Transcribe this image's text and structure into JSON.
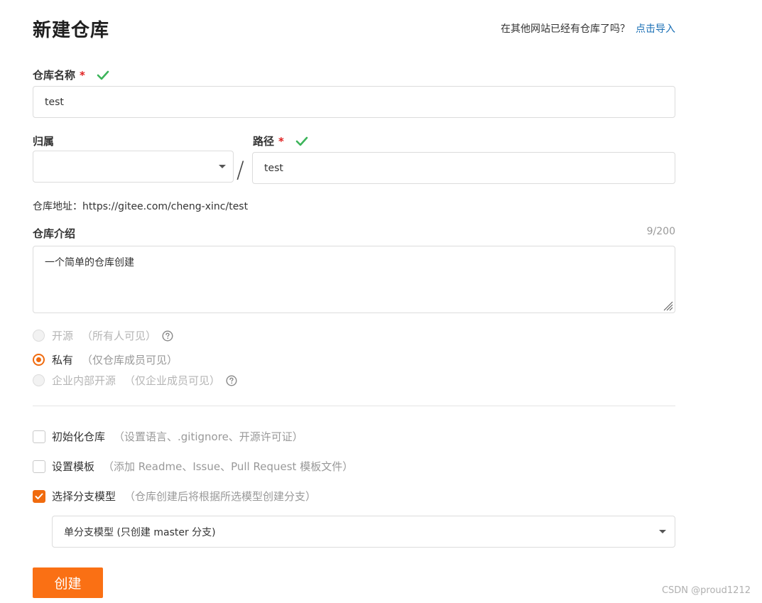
{
  "page": {
    "title": "新建仓库",
    "import_hint": "在其他网站已经有仓库了吗？",
    "import_link": "点击导入"
  },
  "repo_name": {
    "label": "仓库名称",
    "required_mark": "*",
    "value": "test"
  },
  "owner": {
    "label": "归属",
    "value": ""
  },
  "separator": "/",
  "path": {
    "label": "路径",
    "required_mark": "*",
    "value": "test"
  },
  "repo_address": "仓库地址：https://gitee.com/cheng-xinc/test",
  "description": {
    "label": "仓库介绍",
    "counter": "9/200",
    "value": "一个简单的仓库创建"
  },
  "visibility": [
    {
      "label": "开源",
      "sub": "（所有人可见）",
      "selected": false,
      "disabled": true,
      "has_help": true
    },
    {
      "label": "私有",
      "sub": "（仅仓库成员可见）",
      "selected": true,
      "disabled": false,
      "has_help": false
    },
    {
      "label": "企业内部开源",
      "sub": "（仅企业成员可见）",
      "selected": false,
      "disabled": true,
      "has_help": true
    }
  ],
  "options": [
    {
      "label": "初始化仓库",
      "sub": "（设置语言、.gitignore、开源许可证）",
      "checked": false
    },
    {
      "label": "设置模板",
      "sub": "（添加 Readme、Issue、Pull Request 模板文件）",
      "checked": false
    },
    {
      "label": "选择分支模型",
      "sub": "（仓库创建后将根据所选模型创建分支）",
      "checked": true
    }
  ],
  "branch_model": {
    "selected": "单分支模型 (只创建 master 分支)"
  },
  "create_button": "创建",
  "watermark": "CSDN @proud1212",
  "colors": {
    "accent": "#fa7014",
    "link": "#1a6fb5",
    "valid": "#3cb45a",
    "required": "#e02020"
  },
  "icons": {
    "valid": "check-icon",
    "help": "question-circle-icon",
    "dropdown": "caret-down-icon",
    "checked": "checkmark-icon"
  }
}
